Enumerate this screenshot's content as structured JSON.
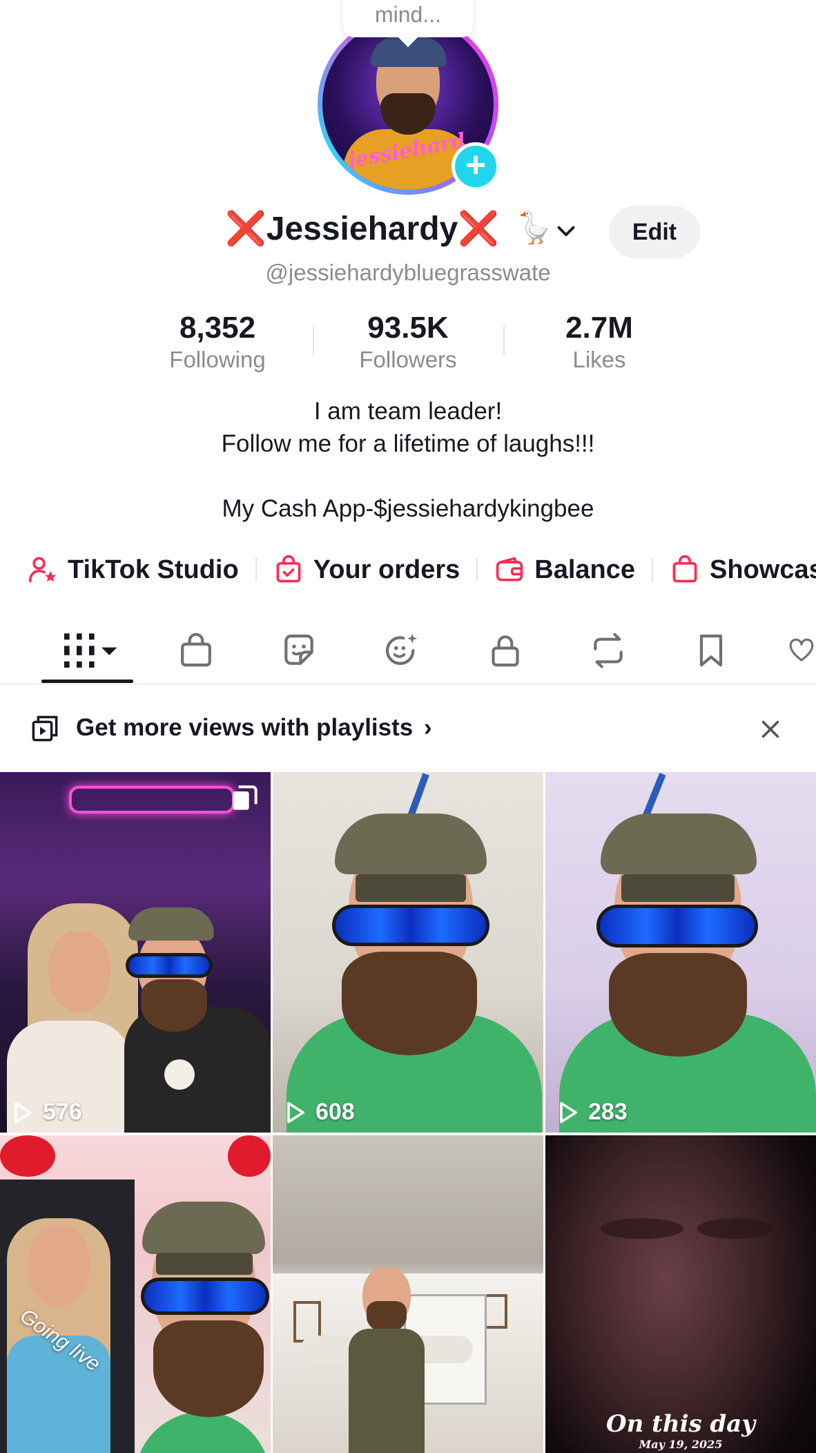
{
  "profile": {
    "status_bubble": "mind...",
    "avatar_script": "jessiehard",
    "name": "Jessiehardy",
    "name_prefix_icon": "❌",
    "name_suffix_icon": "❌",
    "name_emoji": "🪿",
    "edit_label": "Edit",
    "handle": "@jessiehardybluegrasswate",
    "stats": [
      {
        "value": "8,352",
        "label": "Following"
      },
      {
        "value": "93.5K",
        "label": "Followers"
      },
      {
        "value": "2.7M",
        "label": "Likes"
      }
    ],
    "bio": {
      "line1": "I am team leader!",
      "line2": "Follow me for a lifetime of laughs!!!",
      "line3": "My Cash App-$jessiehardykingbee"
    }
  },
  "links": [
    {
      "label": "TikTok Studio",
      "icon": "person-star-icon"
    },
    {
      "label": "Your orders",
      "icon": "shopping-bag-check-icon"
    },
    {
      "label": "Balance",
      "icon": "wallet-icon"
    },
    {
      "label": "Showcase",
      "icon": "shopping-bag-icon"
    }
  ],
  "tabs": [
    {
      "name": "videos",
      "icon": "grid-icon",
      "active": true
    },
    {
      "name": "shop",
      "icon": "bag-icon"
    },
    {
      "name": "stickers",
      "icon": "sticker-icon"
    },
    {
      "name": "effects",
      "icon": "sparkle-face-icon"
    },
    {
      "name": "private",
      "icon": "lock-icon"
    },
    {
      "name": "reposts",
      "icon": "repost-icon"
    },
    {
      "name": "favorites",
      "icon": "bookmark-icon"
    },
    {
      "name": "liked",
      "icon": "heart-icon"
    }
  ],
  "banner": {
    "text": "Get more views with playlists",
    "chevron": "›"
  },
  "grid": [
    {
      "views": "576"
    },
    {
      "views": "608"
    },
    {
      "views": "283"
    },
    {
      "overlay_text": "Going live"
    },
    {},
    {
      "overlay_title": "On this day",
      "overlay_date": "May 19, 2025"
    }
  ],
  "colors": {
    "accent": "#fe2c55",
    "plus": "#20d5ec",
    "text": "#161823",
    "muted": "#8a8b91",
    "x_red": "#e5171f"
  }
}
